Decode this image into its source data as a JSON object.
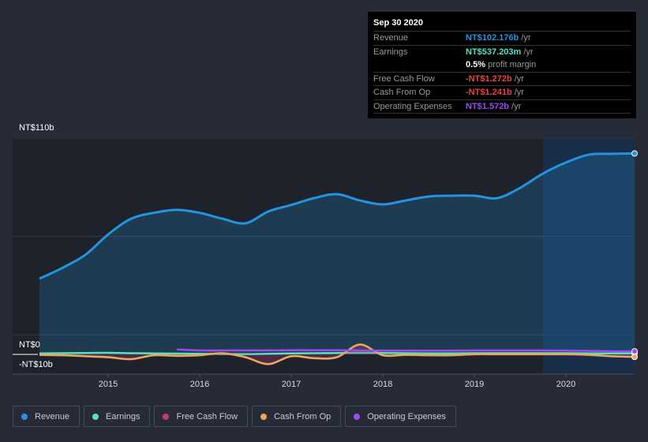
{
  "colors": {
    "revenue": "#2394df",
    "earnings": "#58e2c2",
    "fcf": "#b9407a",
    "cfo": "#e8a95a",
    "opex": "#9c4bf0"
  },
  "tooltip": {
    "date": "Sep 30 2020",
    "rows": [
      {
        "label": "Revenue",
        "value": "NT$102.176b",
        "unit": "/yr",
        "color": "#2394df"
      },
      {
        "label": "Earnings",
        "value": "NT$537.203m",
        "unit": "/yr",
        "color": "#58e2c2"
      },
      {
        "label": "",
        "value": "0.5%",
        "unit": "profit margin",
        "color": "#ffffff"
      },
      {
        "label": "Free Cash Flow",
        "value": "-NT$1.272b",
        "unit": "/yr",
        "color": "#f0403c"
      },
      {
        "label": "Cash From Op",
        "value": "-NT$1.241b",
        "unit": "/yr",
        "color": "#f0403c"
      },
      {
        "label": "Operating Expenses",
        "value": "NT$1.572b",
        "unit": "/yr",
        "color": "#9c4bf0"
      }
    ]
  },
  "legend": [
    {
      "label": "Revenue",
      "color": "#2394df"
    },
    {
      "label": "Earnings",
      "color": "#58e2c2"
    },
    {
      "label": "Free Cash Flow",
      "color": "#b9407a"
    },
    {
      "label": "Cash From Op",
      "color": "#e8a95a"
    },
    {
      "label": "Operating Expenses",
      "color": "#9c4bf0"
    }
  ],
  "chart_data": {
    "type": "line",
    "ylabel_top": "NT$110b",
    "ylabel_zero": "NT$0",
    "ylabel_bottom": "-NT$10b",
    "ylim": [
      -10,
      110
    ],
    "xlim": [
      2014.25,
      2020.75
    ],
    "xticks": [
      "2015",
      "2016",
      "2017",
      "2018",
      "2019",
      "2020"
    ],
    "highlight_from": 2019.75,
    "x": [
      2014.25,
      2014.5,
      2014.75,
      2015,
      2015.25,
      2015.5,
      2015.75,
      2016,
      2016.25,
      2016.5,
      2016.75,
      2017,
      2017.25,
      2017.5,
      2017.75,
      2018,
      2018.25,
      2018.5,
      2018.75,
      2019,
      2019.25,
      2019.5,
      2019.75,
      2020,
      2020.25,
      2020.5,
      2020.75
    ],
    "series": [
      {
        "name": "Revenue",
        "key": "revenue",
        "values": [
          38.5,
          44,
          50.6,
          61,
          69,
          72,
          73.5,
          72,
          69,
          66.7,
          72.7,
          76,
          79.5,
          81.5,
          78.3,
          76.3,
          78.3,
          80.3,
          80.7,
          80.7,
          79.5,
          84.7,
          92,
          97.6,
          101.6,
          102,
          102.2
        ]
      },
      {
        "name": "Earnings",
        "key": "earnings",
        "values": [
          0.5,
          0.6,
          0.7,
          0.8,
          0.6,
          0.5,
          0.4,
          0.3,
          0.2,
          0.1,
          0.3,
          0.5,
          0.6,
          0.7,
          0.8,
          0.7,
          0.6,
          0.5,
          0.5,
          0.6,
          0.6,
          0.6,
          0.6,
          0.6,
          0.5,
          0.5,
          0.54
        ]
      },
      {
        "name": "Free Cash Flow",
        "key": "fcf",
        "values": [
          -0.3,
          -0.5,
          -1,
          -1.5,
          -2.5,
          -0.5,
          -0.8,
          -0.5,
          0.5,
          -1.5,
          -5,
          -1,
          -2,
          -1.5,
          5,
          -0.5,
          -0.3,
          -0.5,
          -0.5,
          0,
          0,
          0,
          0,
          0,
          -0.3,
          -1,
          -1.27
        ]
      },
      {
        "name": "Cash From Op",
        "key": "cfo",
        "values": [
          -0.2,
          -0.4,
          -0.9,
          -1.4,
          -2.4,
          -0.4,
          -0.7,
          -0.4,
          0.6,
          -1.4,
          -4.9,
          -0.9,
          -1.9,
          -1.4,
          5,
          -0.4,
          -0.2,
          -0.4,
          -0.4,
          0.1,
          0.1,
          0.1,
          0.1,
          0.1,
          -0.2,
          -0.9,
          -1.24
        ]
      },
      {
        "name": "Operating Expenses",
        "key": "opex",
        "values": [
          null,
          null,
          null,
          null,
          null,
          null,
          2.5,
          2,
          2,
          2,
          2,
          2.1,
          2.1,
          2.1,
          2,
          1.9,
          1.9,
          1.9,
          1.9,
          2,
          2,
          2,
          2,
          1.9,
          1.8,
          1.6,
          1.57
        ]
      }
    ]
  }
}
